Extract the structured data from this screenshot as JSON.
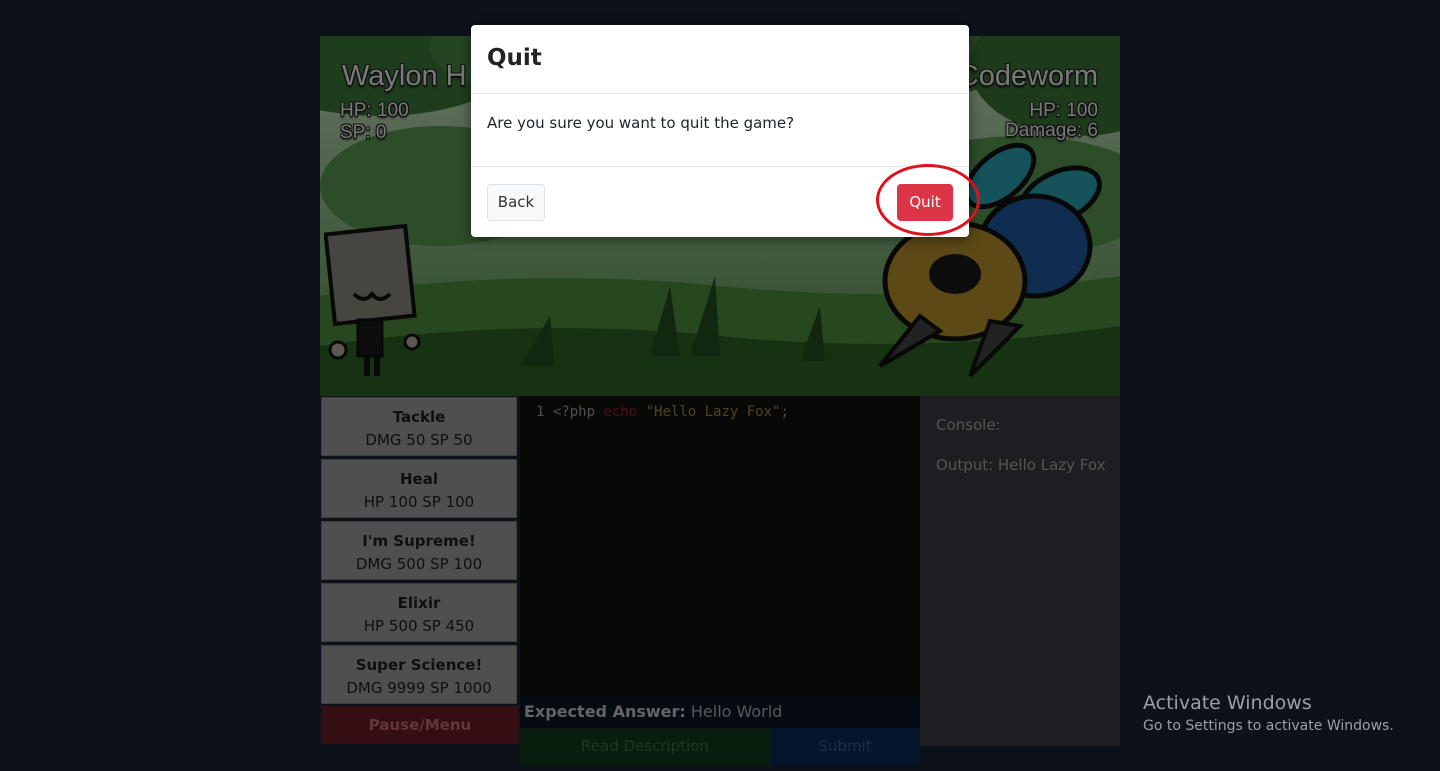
{
  "battle": {
    "player": {
      "name": "Waylon H",
      "hp": "HP: 100",
      "sp": "SP: 0"
    },
    "enemy": {
      "name": "Codeworm",
      "hp": "HP: 100",
      "damage": "Damage: 6"
    }
  },
  "skills": [
    {
      "name": "Tackle",
      "stats": "DMG 50 SP 50"
    },
    {
      "name": "Heal",
      "stats": "HP 100 SP 100"
    },
    {
      "name": "I'm Supreme!",
      "stats": "DMG 500 SP 100"
    },
    {
      "name": "Elixir",
      "stats": "HP 500 SP 450"
    },
    {
      "name": "Super Science!",
      "stats": "DMG 9999 SP 1000"
    }
  ],
  "pause_label": "Pause/Menu",
  "editor": {
    "line_number": "1",
    "code_open": "<?php ",
    "code_keyword": "echo",
    "code_string": "\"Hello Lazy Fox\"",
    "code_end": ";"
  },
  "expected": {
    "label": "Expected Answer:",
    "value": " Hello World"
  },
  "buttons": {
    "read_description": "Read Description",
    "submit": "Submit"
  },
  "console": {
    "label": "Console:",
    "output": "Output: Hello Lazy Fox"
  },
  "modal": {
    "title": "Quit",
    "message": "Are you sure you want to quit the game?",
    "back_label": "Back",
    "quit_label": "Quit"
  },
  "watermark": {
    "title": "Activate Windows",
    "subtitle": "Go to Settings to activate Windows."
  },
  "colors": {
    "quit": "#dc3545",
    "highlight": "#e0101c",
    "pause": "#6b1d27"
  }
}
